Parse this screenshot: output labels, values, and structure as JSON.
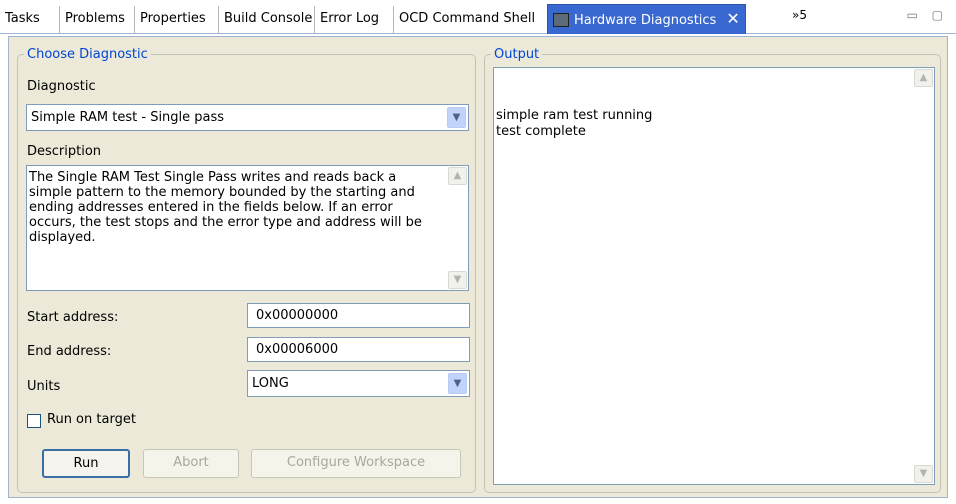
{
  "tabs": [
    {
      "label": "Tasks"
    },
    {
      "label": "Problems"
    },
    {
      "label": "Properties"
    },
    {
      "label": "Build Console"
    },
    {
      "label": "Error Log"
    },
    {
      "label": "OCD Command Shell"
    },
    {
      "label": "Hardware Diagnostics",
      "active": true
    }
  ],
  "tab_overflow": "»5",
  "view_controls": "▭ ▢",
  "choose_diagnostic": {
    "legend": "Choose Diagnostic",
    "diagnostic_label": "Diagnostic",
    "diagnostic_value": "Simple RAM test - Single pass",
    "description_label": "Description",
    "description_text": "The Single RAM Test Single Pass writes and reads back a simple pattern to the memory bounded by the starting and ending addresses entered in the fields below. If an error occurs, the test stops and the error type and address will be displayed.",
    "start_address_label": "Start address:",
    "start_address_value": "0x00000000",
    "end_address_label": "End address:",
    "end_address_value": "0x00006000",
    "units_label": "Units",
    "units_value": "LONG",
    "run_on_target_label": "Run on target",
    "run_on_target_checked": false,
    "buttons": {
      "run": "Run",
      "abort": "Abort",
      "configure": "Configure Workspace"
    }
  },
  "output": {
    "legend": "Output",
    "text": "simple ram test running\ntest complete"
  }
}
